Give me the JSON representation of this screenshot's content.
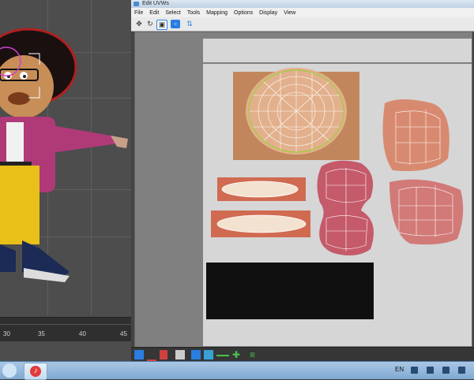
{
  "window": {
    "title": "Edit UVWs"
  },
  "menu": [
    "File",
    "Edit",
    "Select",
    "Tools",
    "Mapping",
    "Options",
    "Display",
    "View"
  ],
  "timeline": {
    "ticks": [
      "30",
      "35",
      "40",
      "45"
    ]
  },
  "taskbar": {
    "language": "EN"
  },
  "icons": {
    "toolbar": [
      "move-icon",
      "rotate-icon",
      "scale-icon",
      "freeform-icon",
      "mirror-icon"
    ],
    "bottom": [
      "select-vertex-icon",
      "select-edge-icon",
      "select-face-icon",
      "element-icon",
      "grow-icon",
      "shrink-icon",
      "loop-icon",
      "ring-icon",
      "paint-select-icon"
    ]
  },
  "colors": {
    "accent": "#2a7de1",
    "uv_canvas": "#d6d6d6",
    "taskbar": "#7fa9d3"
  }
}
